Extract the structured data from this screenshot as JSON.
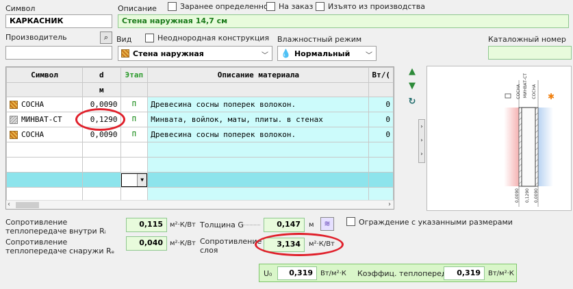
{
  "labels": {
    "symbol": "Символ",
    "description": "Описание",
    "manufacturer": "Производитель",
    "view": "Вид",
    "humidity": "Влажностный режим",
    "catalog": "Каталожный номер"
  },
  "symbol_value": "КАРКАСНИК",
  "description_value": "Стена наружная 14,7 см",
  "checkboxes": {
    "predefined": "Заранее определенное",
    "to_order": "На заказ",
    "discontinued": "Изъято из производства",
    "non_uniform": "Неоднородная конструкция",
    "fixed_size": "Ограждение с указанными размерами"
  },
  "view_value": "Стена наружная",
  "humidity_value": "Нормальный",
  "grid": {
    "headers": [
      "Символ",
      "d",
      "Этап",
      "Описание материала",
      "Вт/("
    ],
    "units": [
      "",
      "м",
      "",
      "",
      ""
    ],
    "rows": [
      {
        "symbol": "СОСНА",
        "d": "0,0090",
        "etap": "П",
        "desc": "Древесина сосны поперек волокон.",
        "last": "0"
      },
      {
        "symbol": "МИНВАТ-СТ",
        "d": "0,1290",
        "etap": "П",
        "desc": "Минвата, войлок, маты, плиты. в стенах",
        "last": "0"
      },
      {
        "symbol": "СОСНА",
        "d": "0,0090",
        "etap": "П",
        "desc": "Древесина сосны поперек волокон.",
        "last": "0"
      }
    ]
  },
  "diagram": {
    "layer_labels": [
      "СОСНА",
      "МИНВАТ-СТ",
      "СОСНА"
    ],
    "bottom_values": [
      "0,0090",
      "0,1290",
      "0,0090"
    ]
  },
  "results": {
    "ri_label": "Сопротивление теплопередаче внутри Rᵢ",
    "ri_value": "0,115",
    "re_label": "Сопротивление теплопередаче снаружи Rₑ",
    "re_value": "0,040",
    "r_unit": "м²·К/Вт",
    "thickness_label": "Толщина G",
    "thickness_value": "0,147",
    "thickness_unit": "м",
    "layer_r_label": "Сопротивление слоя",
    "layer_r_value": "3,134",
    "u0_label": "U₀",
    "u0_value": "0,319",
    "u0_unit": "Вт/м²·К",
    "u_label": "Коэффиц. теплоперед.U",
    "u_value": "0,319",
    "u_unit": "Вт/м²·К"
  },
  "colors": {
    "accent_green": "#8fc78f",
    "highlight_cyan": "#ccfbfb",
    "selected_row": "#8de4ec",
    "annotation_red": "#e01f2a"
  }
}
